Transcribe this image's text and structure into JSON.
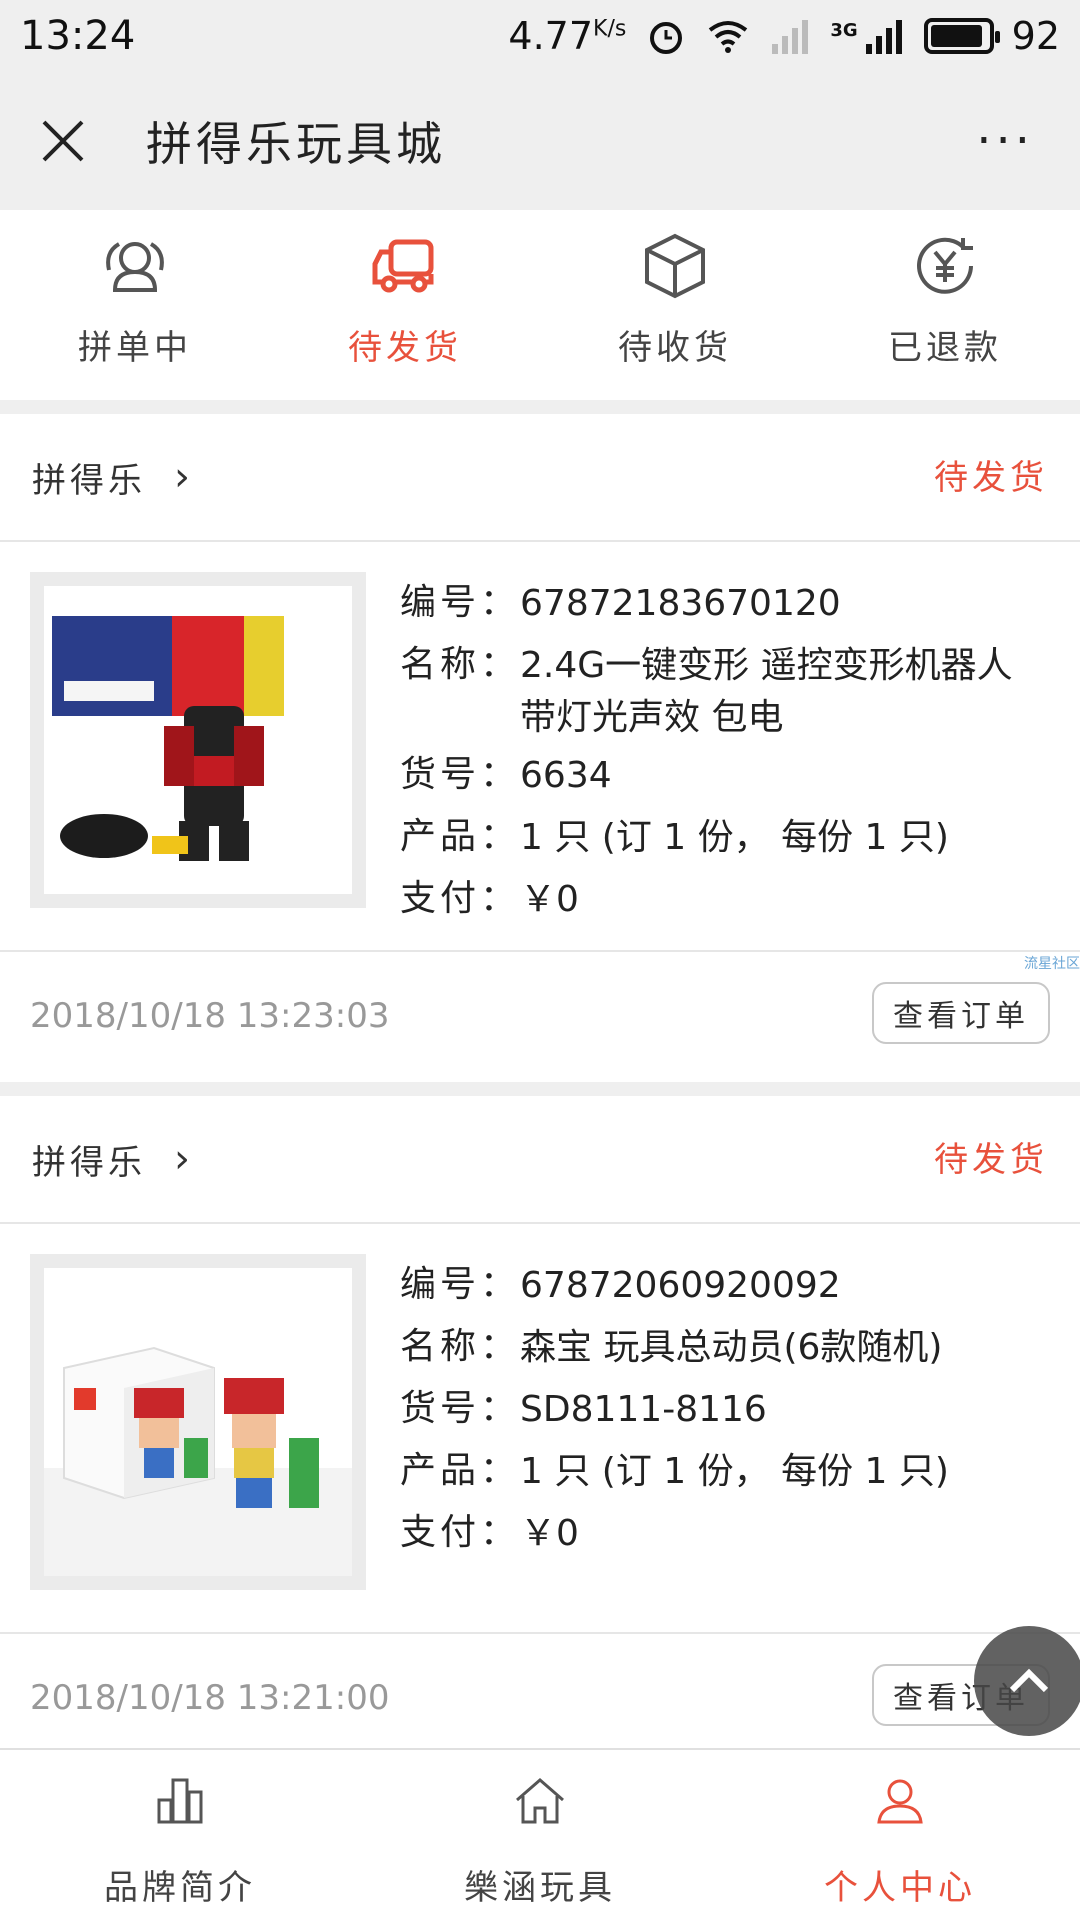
{
  "status_bar": {
    "time": "13:24",
    "speed": "4.77",
    "speed_unit": "K/s",
    "network": "3G",
    "battery": "92"
  },
  "titlebar": {
    "title": "拼得乐玩具城",
    "more": "···"
  },
  "tabs": [
    {
      "label": "拼单中",
      "icon": "group-icon",
      "active": false
    },
    {
      "label": "待发货",
      "icon": "truck-icon",
      "active": true
    },
    {
      "label": "待收货",
      "icon": "box-icon",
      "active": false
    },
    {
      "label": "已退款",
      "icon": "refund-icon",
      "active": false
    }
  ],
  "orders": [
    {
      "shop": "拼得乐",
      "status": "待发货",
      "fields": [
        {
          "key": "编号：",
          "value": "67872183670120"
        },
        {
          "key": "名称：",
          "value": "2.4G一键变形 遥控变形机器人带灯光声效 包电"
        },
        {
          "key": "货号：",
          "value": "6634"
        },
        {
          "key": "产品：",
          "value": "1 只 (订 1 份， 每份 1 只)"
        },
        {
          "key": "支付：",
          "value": "￥0"
        }
      ],
      "time": "2018/10/18 13:23:03",
      "action": "查看订单"
    },
    {
      "shop": "拼得乐",
      "status": "待发货",
      "fields": [
        {
          "key": "编号：",
          "value": "67872060920092"
        },
        {
          "key": "名称：",
          "value": "森宝 玩具总动员(6款随机)"
        },
        {
          "key": "货号：",
          "value": "SD8111-8116"
        },
        {
          "key": "产品：",
          "value": "1 只 (订 1 份， 每份 1 只)"
        },
        {
          "key": "支付：",
          "value": "￥0"
        }
      ],
      "time": "2018/10/18 13:21:00",
      "action": "查看订单"
    }
  ],
  "watermark": "流星社区",
  "bottom_nav": [
    {
      "label": "品牌简介",
      "icon": "chart-icon",
      "active": false
    },
    {
      "label": "樂涵玩具",
      "icon": "home-icon",
      "active": false
    },
    {
      "label": "个人中心",
      "icon": "user-icon",
      "active": true
    }
  ],
  "colors": {
    "accent": "#e8513c",
    "background": "#efefef",
    "muted": "#999999"
  }
}
